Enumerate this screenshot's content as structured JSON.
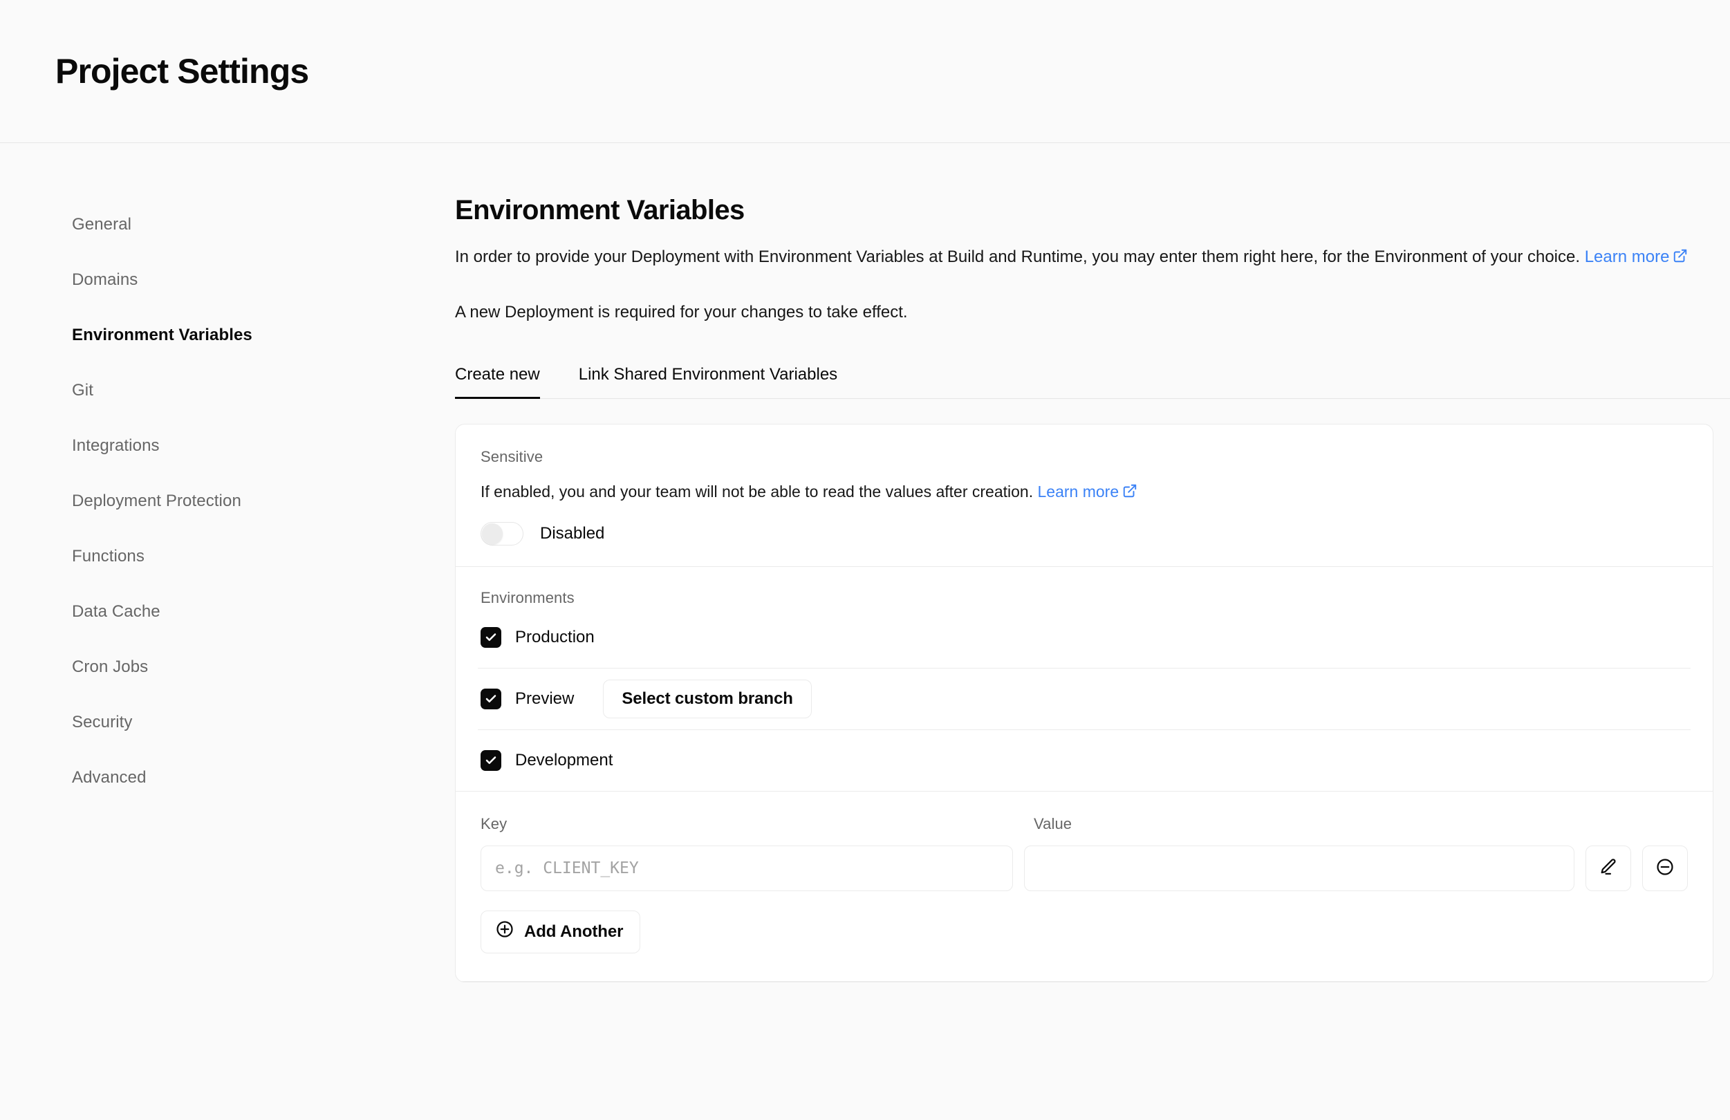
{
  "header": {
    "title": "Project Settings"
  },
  "sidebar": {
    "items": [
      {
        "label": "General"
      },
      {
        "label": "Domains"
      },
      {
        "label": "Environment Variables"
      },
      {
        "label": "Git"
      },
      {
        "label": "Integrations"
      },
      {
        "label": "Deployment Protection"
      },
      {
        "label": "Functions"
      },
      {
        "label": "Data Cache"
      },
      {
        "label": "Cron Jobs"
      },
      {
        "label": "Security"
      },
      {
        "label": "Advanced"
      }
    ],
    "active_index": 2
  },
  "main": {
    "section_title": "Environment Variables",
    "description_before_link": "In order to provide your Deployment with Environment Variables at Build and Runtime, you may enter them right here, for the Environment of your choice. ",
    "description_link": "Learn more",
    "deploy_note": "A new Deployment is required for your changes to take effect.",
    "tabs": [
      {
        "label": "Create new",
        "active": true
      },
      {
        "label": "Link Shared Environment Variables",
        "active": false
      }
    ]
  },
  "card": {
    "sensitive": {
      "label": "Sensitive",
      "description_before_link": "If enabled, you and your team will not be able to read the values after creation. ",
      "description_link": "Learn more",
      "toggle_state_label": "Disabled",
      "toggle_enabled": false
    },
    "environments": {
      "label": "Environments",
      "rows": [
        {
          "name": "Production",
          "checked": true,
          "button": null
        },
        {
          "name": "Preview",
          "checked": true,
          "button": "Select custom branch"
        },
        {
          "name": "Development",
          "checked": true,
          "button": null
        }
      ]
    },
    "key_value": {
      "key_label": "Key",
      "value_label": "Value",
      "key_placeholder": "e.g. CLIENT_KEY",
      "key_value": "",
      "value_placeholder": "",
      "value_value": "",
      "edit_icon": "pencil-icon",
      "remove_icon": "minus-circle-icon",
      "add_another_label": "Add Another"
    }
  },
  "colors": {
    "page_bg": "#fafafa",
    "card_bg": "#ffffff",
    "border": "#ebebeb",
    "accent_link": "#3b82f6",
    "text_primary": "#0a0a0a",
    "text_muted": "#666666",
    "checkbox_fill": "#0a0a0a"
  }
}
